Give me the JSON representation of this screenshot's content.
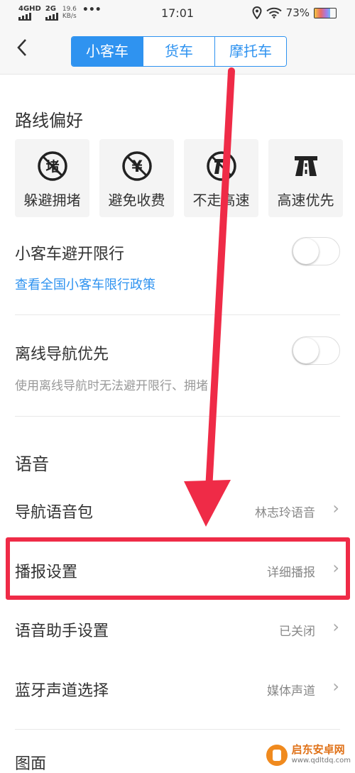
{
  "status_bar": {
    "net1": "4GHD",
    "net2": "2G",
    "speed": "19.6",
    "speed_unit": "KB/s",
    "dots": "•••",
    "time": "17:01",
    "battery": "73%"
  },
  "header": {
    "back_glyph": "‹",
    "tabs": [
      "小客车",
      "货车",
      "摩托车"
    ]
  },
  "route": {
    "title": "路线偏好",
    "options": [
      {
        "label": "躲避拥堵",
        "icon": "avoid-congestion-icon"
      },
      {
        "label": "避免收费",
        "icon": "avoid-toll-icon"
      },
      {
        "label": "不走高速",
        "icon": "avoid-highway-icon"
      },
      {
        "label": "高速优先",
        "icon": "highway-first-icon"
      }
    ]
  },
  "restriction": {
    "title": "小客车避开限行",
    "link": "查看全国小客车限行政策"
  },
  "offline": {
    "title": "离线导航优先",
    "subtitle": "使用离线导航时无法避开限行、拥堵"
  },
  "voice": {
    "title": "语音",
    "rows": [
      {
        "label": "导航语音包",
        "value": "林志玲语音"
      },
      {
        "label": "播报设置",
        "value": "详细播报"
      },
      {
        "label": "语音助手设置",
        "value": "已关闭"
      },
      {
        "label": "蓝牙声道选择",
        "value": "媒体声道"
      }
    ]
  },
  "next_section": {
    "title": "图面"
  },
  "watermark": {
    "name": "启东安卓网",
    "url": "www.qdltdq.com"
  },
  "colors": {
    "accent": "#2f93f0",
    "annotation": "#ef2b47"
  },
  "chevron": "›"
}
